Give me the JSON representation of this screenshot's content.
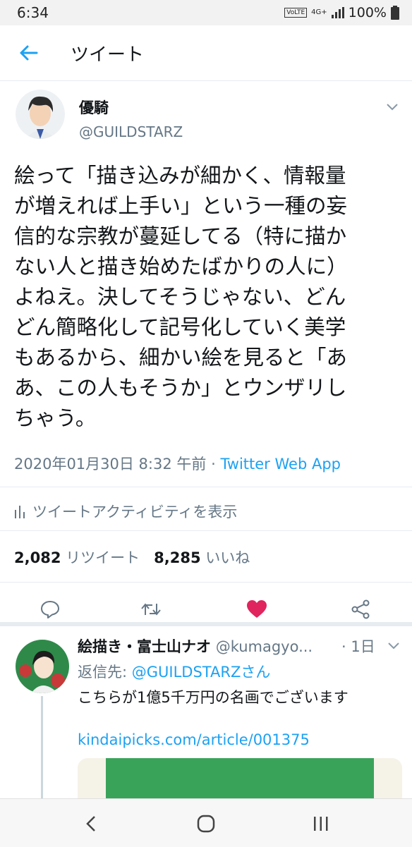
{
  "status_bar": {
    "time": "6:34",
    "volte": "VoLTE",
    "network": "4G+",
    "battery": "100%"
  },
  "header": {
    "title": "ツイート"
  },
  "tweet": {
    "author_name": "優騎",
    "author_handle": "@GUILDSTARZ",
    "text": "絵って「描き込みが細かく、情報量\nが増えれば上手い」という一種の妄\n信的な宗教が蔓延してる（特に描か\nない人と描き始めたばかりの人に）\nよねえ。決してそうじゃない、どん\nどん簡略化して記号化していく美学\nもあるから、細かい絵を見ると「あ\nあ、この人もそうか」とウンザリし\nちゃう。",
    "timestamp": "2020年01月30日 8:32 午前",
    "separator": " · ",
    "source": "Twitter Web App",
    "activity_label": "ツイートアクティビティを表示",
    "retweet_count": "2,082",
    "retweet_label": "リツイート",
    "like_count": "8,285",
    "like_label": "いいね"
  },
  "reply": {
    "author_name": "絵描き・富士山ナオ",
    "author_handle": "@kumagyo...",
    "time": "· 1日",
    "reply_to_label": "返信先: ",
    "reply_to_mention": "@GUILDSTARZさん",
    "text": "こちらが1億5千万円の名画でございます",
    "link": "kindaipicks.com/article/001375"
  },
  "colors": {
    "accent": "#1da1f2",
    "like": "#e0245e",
    "muted": "#657786"
  },
  "icons": [
    "back-arrow-icon",
    "chevron-down-icon",
    "bar-chart-icon",
    "reply-icon",
    "retweet-icon",
    "heart-icon",
    "share-icon",
    "nav-back-icon",
    "nav-home-icon",
    "nav-recents-icon"
  ]
}
